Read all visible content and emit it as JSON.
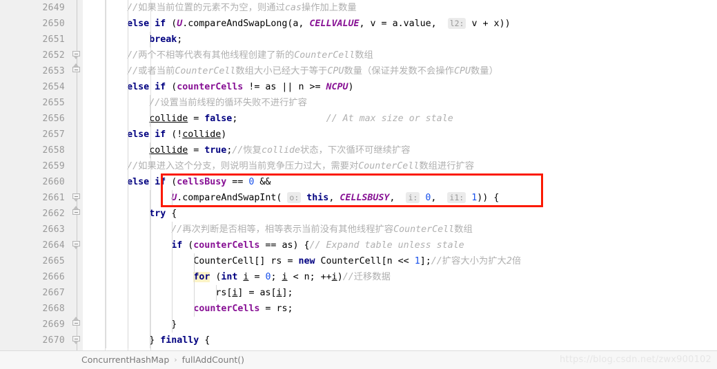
{
  "editor": {
    "first_line_number": 2649,
    "line_count": 22,
    "line_numbers": [
      2649,
      2650,
      2651,
      2652,
      2653,
      2654,
      2655,
      2656,
      2657,
      2658,
      2659,
      2660,
      2661,
      2662,
      2663,
      2664,
      2665,
      2666,
      2667,
      2668,
      2669,
      2670
    ],
    "fold_markers": [
      {
        "line": 2652,
        "type": "down"
      },
      {
        "line": 2653,
        "type": "up"
      },
      {
        "line": 2661,
        "type": "down"
      },
      {
        "line": 2662,
        "type": "up"
      },
      {
        "line": 2664,
        "type": "down"
      },
      {
        "line": 2669,
        "type": "up"
      },
      {
        "line": 2670,
        "type": "down"
      }
    ],
    "lines": [
      {
        "n": 2649,
        "text": "        //如果当前位置的元素不为空，则通过cas操作加上数量"
      },
      {
        "n": 2650,
        "text": "        else if (U.compareAndSwapLong(a, CELLVALUE, v = a.value,  l2: v + x))"
      },
      {
        "n": 2651,
        "text": "            break;"
      },
      {
        "n": 2652,
        "text": "        //两个不相等代表有其他线程创建了新的CounterCell数组"
      },
      {
        "n": 2653,
        "text": "        //或者当前CounterCell数组大小已经大于等于CPU数量（保证并发数不会操作CPU数量）"
      },
      {
        "n": 2654,
        "text": "        else if (counterCells != as || n >= NCPU)"
      },
      {
        "n": 2655,
        "text": "            //设置当前线程的循环失败不进行扩容"
      },
      {
        "n": 2656,
        "text": "            collide = false;                // At max size or stale"
      },
      {
        "n": 2657,
        "text": "        else if (!collide)"
      },
      {
        "n": 2658,
        "text": "            collide = true;//恢复collide状态，下次循环可继续扩容"
      },
      {
        "n": 2659,
        "text": "        //如果进入这个分支，则说明当前竞争压力过大，需要对CounterCell数组进行扩容"
      },
      {
        "n": 2660,
        "text": "        else if (cellsBusy == 0 &&"
      },
      {
        "n": 2661,
        "text": "                U.compareAndSwapInt( o: this, CELLSBUSY,  i: 0,  i1: 1)) {"
      },
      {
        "n": 2662,
        "text": "            try {"
      },
      {
        "n": 2663,
        "text": "                //再次判断是否相等，相等表示当前没有其他线程扩容CounterCell数组"
      },
      {
        "n": 2664,
        "text": "                if (counterCells == as) {// Expand table unless stale"
      },
      {
        "n": 2665,
        "text": "                    CounterCell[] rs = new CounterCell[n << 1];//扩容大小为扩大2倍"
      },
      {
        "n": 2666,
        "text": "                    for (int i = 0; i < n; ++i)//迁移数据"
      },
      {
        "n": 2667,
        "text": "                        rs[i] = as[i];"
      },
      {
        "n": 2668,
        "text": "                    counterCells = rs;"
      },
      {
        "n": 2669,
        "text": "                }"
      },
      {
        "n": 2670,
        "text": "            } finally {"
      }
    ],
    "highlight_box": {
      "label": "red-annotation-rectangle",
      "color": "#fb1900",
      "covers_lines": [
        2660,
        2661
      ]
    },
    "inlay_hints": [
      "l2:",
      "o:",
      "i:",
      "i1:"
    ],
    "keyword_highlight": "for",
    "colors": {
      "keyword": "#000080",
      "field": "#871094",
      "static_field": "#871094",
      "number": "#1750eb",
      "comment": "#b0b0b0",
      "gutter_bg": "#f0f0f0",
      "line_number": "#999999",
      "editor_bg": "#ffffff",
      "annotation": "#fb1900",
      "keyword_highlight_bg": "#fcf3c7"
    }
  },
  "statusbar": {
    "breadcrumb": {
      "class_name": "ConcurrentHashMap",
      "separator": "›",
      "method_name": "fullAddCount()"
    },
    "watermark": "https://blog.csdn.net/zwx900102"
  }
}
